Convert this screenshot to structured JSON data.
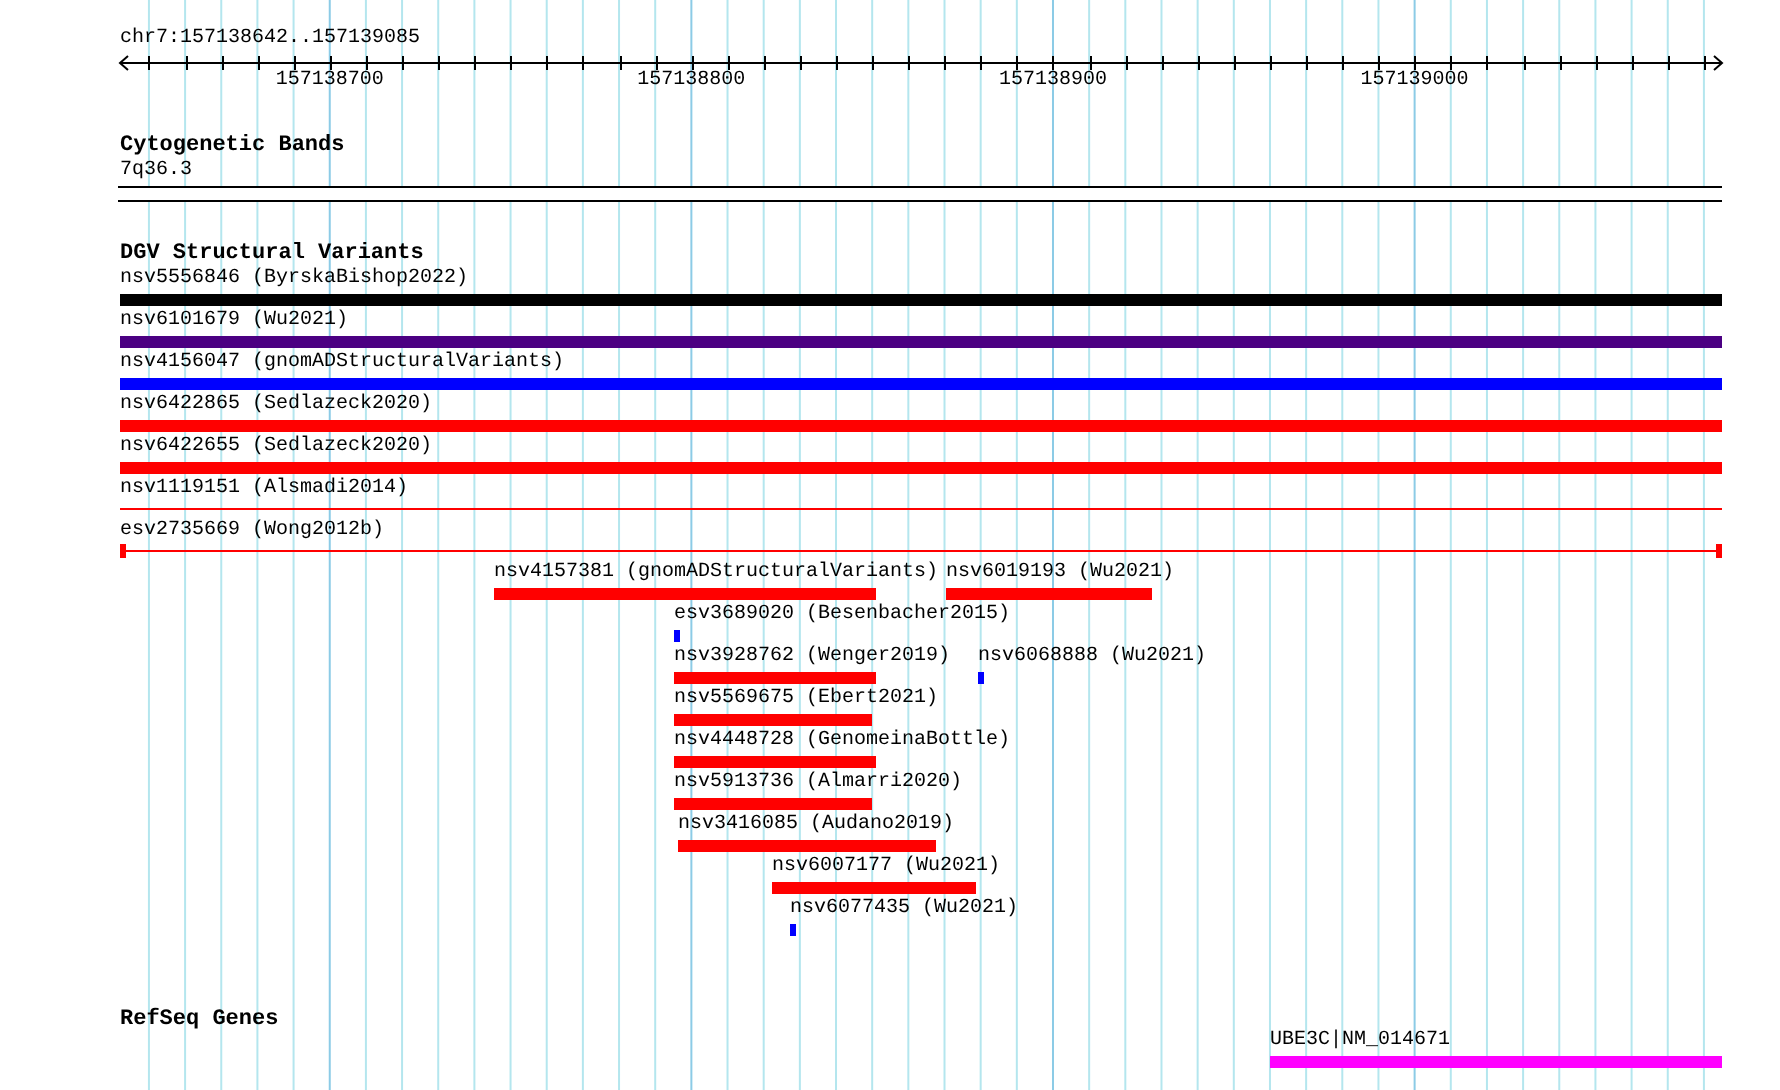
{
  "ruler": {
    "location": "chr7:157138642..157139085",
    "tick_labels": [
      "157138700",
      "157138800",
      "157138900",
      "157139000"
    ]
  },
  "cytogenetic_bands": {
    "title": "Cytogenetic Bands",
    "features": [
      {
        "label": "7q36.3",
        "kind": "band"
      }
    ]
  },
  "dgv_structural_variants": {
    "title": "DGV Structural Variants",
    "features": [
      {
        "label": "nsv5556846 (ByrskaBishop2022)",
        "kind": "bar",
        "color": "#000000"
      },
      {
        "label": "nsv6101679 (Wu2021)",
        "kind": "bar",
        "color": "#4b0082"
      },
      {
        "label": "nsv4156047 (gnomADStructuralVariants)",
        "kind": "bar",
        "color": "#0000ff"
      },
      {
        "label": "nsv6422865 (Sedlazeck2020)",
        "kind": "bar",
        "color": "#ff0000"
      },
      {
        "label": "nsv6422655 (Sedlazeck2020)",
        "kind": "bar",
        "color": "#ff0000"
      },
      {
        "label": "nsv1119151 (Alsmadi2014)",
        "kind": "line",
        "color": "#ff0000"
      },
      {
        "label": "esv2735669 (Wong2012b)",
        "kind": "capped-line",
        "color": "#ff0000"
      },
      {
        "label": "nsv4157381 (gnomADStructuralVariants)",
        "kind": "bar",
        "color": "#ff0000"
      },
      {
        "label": "nsv6019193 (Wu2021)",
        "kind": "bar",
        "color": "#ff0000"
      },
      {
        "label": "esv3689020 (Besenbacher2015)",
        "kind": "bar",
        "color": "#0000ff"
      },
      {
        "label": "nsv3928762 (Wenger2019)",
        "kind": "bar",
        "color": "#ff0000"
      },
      {
        "label": "nsv6068888 (Wu2021)",
        "kind": "bar",
        "color": "#0000ff"
      },
      {
        "label": "nsv5569675 (Ebert2021)",
        "kind": "bar",
        "color": "#ff0000"
      },
      {
        "label": "nsv4448728 (GenomeinaBottle)",
        "kind": "bar",
        "color": "#ff0000"
      },
      {
        "label": "nsv5913736 (Almarri2020)",
        "kind": "bar",
        "color": "#ff0000"
      },
      {
        "label": "nsv3416085 (Audano2019)",
        "kind": "bar",
        "color": "#ff0000"
      },
      {
        "label": "nsv6007177 (Wu2021)",
        "kind": "bar",
        "color": "#ff0000"
      },
      {
        "label": "nsv6077435 (Wu2021)",
        "kind": "bar",
        "color": "#0000ff"
      }
    ]
  },
  "refseq_genes": {
    "title": "RefSeq Genes",
    "features": [
      {
        "label": "UBE3C|NM_014671",
        "kind": "bar",
        "color": "#ff00ff"
      }
    ]
  }
}
